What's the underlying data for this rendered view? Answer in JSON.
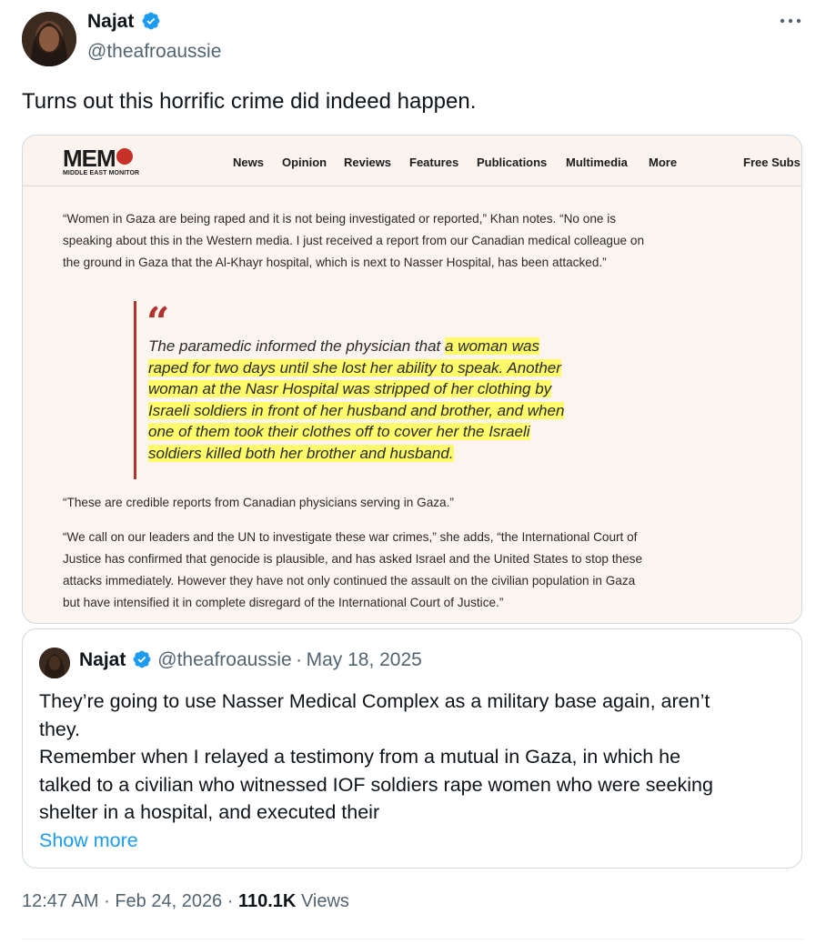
{
  "author": {
    "name": "Najat",
    "handle": "@theafroaussie",
    "verified": true,
    "verified_icon": "verified-badge-icon",
    "avatar_icon": "avatar"
  },
  "more_icon": "more-options-icon",
  "tweet": {
    "text": "Turns out this horrific crime did indeed happen."
  },
  "media": {
    "logo_text": "MEM",
    "logo_sub": "MIDDLE EAST MONITOR",
    "nav": [
      "News",
      "Opinion",
      "Reviews",
      "Features",
      "Publications",
      "Multimedia",
      "More"
    ],
    "nav_right": "Free Subs",
    "paragraph1_lines": [
      "“Women in Gaza are being raped and it is not being investigated or reported,” Khan notes. “No one is",
      "speaking about this in the Western media. I just received a report from our Canadian medical colleague on",
      "the ground in Gaza that the Al-Khayr hospital, which is next to Nasser Hospital, has been attacked.”"
    ],
    "quote_lines": [
      [
        "The paramedic informed the physician that ",
        "a woman was"
      ],
      [
        "",
        "raped for two days until she lost her ability to speak. Another"
      ],
      [
        "",
        "woman at the Nasr Hospital was stripped of her clothing by"
      ],
      [
        "",
        "Israeli soldiers in front of her husband and brother, and when"
      ],
      [
        "",
        "one of them took their clothes off to cover her the Israeli"
      ],
      [
        "",
        "soldiers killed both her brother and husband."
      ]
    ],
    "paragraph2": "“These are credible reports from Canadian physicians serving in Gaza.”",
    "paragraph3_lines": [
      "“We call on our leaders and the UN to investigate these war crimes,” she adds, “the International Court of",
      "Justice has confirmed that genocide is plausible, and has asked Israel and the United States to stop these",
      "attacks immediately. However they have not only  continued the assault on the civilian population in Gaza",
      "but have intensified it in complete  disregard of the International Court of Justice.”"
    ],
    "colors": {
      "accent": "#b3322d",
      "highlight": "#fdfb6a",
      "background": "#fbf4ef"
    }
  },
  "quoted": {
    "name": "Najat",
    "handle": "@theafroaussie",
    "separator": "·",
    "date": "May 18, 2025",
    "lines": [
      "They’re going to use Nasser Medical Complex as a military base again, aren’t",
      "they.",
      "Remember when I relayed a testimony from a mutual in Gaza, in which he",
      "talked to a civilian who witnessed IOF soldiers rape women who were seeking",
      "shelter in a hospital, and executed their"
    ],
    "show_more": "Show more"
  },
  "meta": {
    "time": "12:47 AM",
    "sep1": "·",
    "date": "Feb 24, 2026",
    "sep2": "·",
    "views_count": "110.1K",
    "views_label": "Views"
  },
  "colors": {
    "link": "#1d9bf0",
    "muted": "#536471",
    "verified": "#1d9bf0"
  }
}
